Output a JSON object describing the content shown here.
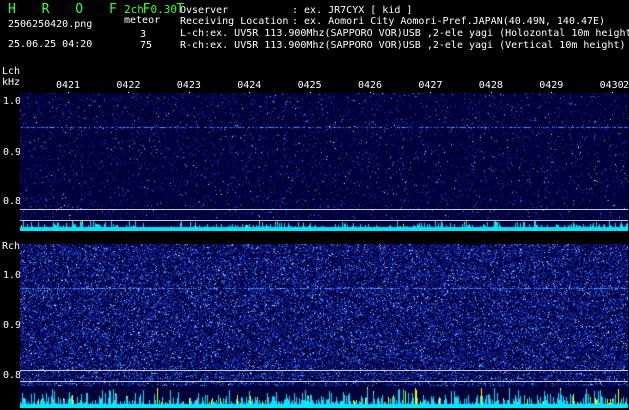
{
  "app": {
    "title": "H R O F F T",
    "version": "2ch 0.30",
    "filename": "2506250420.png",
    "meteor_label": "meteor",
    "datetime": "25.06.25 04:20",
    "lch_count": "3",
    "rch_count": "75"
  },
  "header": {
    "observer_label": "Ovserver",
    "observer_value": ": ex. JR7CYX [ kid ]",
    "location_label": "Receiving Location",
    "location_value": ": ex. Aomori City Aomori-Pref.JAPAN(40.49N, 140.47E)",
    "lch_line": "L-ch:ex. UV5R 113.900Mhz(SAPPORO VOR)USB ,2-ele yagi (Holozontal 10m height)",
    "rch_line": "R-ch:ex. UV5R 113.900Mhz(SAPPORO VOR)USB ,2-ele yagi (Vertical 10m height)"
  },
  "colors": {
    "accent_green": "#39ff39",
    "cyan_level": "#00e6ff",
    "yellow_level": "#ffff00",
    "waterfall_bg": "#00003a"
  },
  "axis": {
    "lch_label": "Lch",
    "rch_label": "Rch",
    "unit": "kHz",
    "time_ticks": [
      "0421",
      "0422",
      "0423",
      "0424",
      "0425",
      "0426",
      "0427",
      "0428",
      "0429",
      "0430",
      "2"
    ],
    "lch_freq_ticks": [
      "1.0",
      "0.9",
      "0.8"
    ],
    "rch_freq_ticks": [
      "1.0",
      "0.9",
      "0.8"
    ]
  }
}
